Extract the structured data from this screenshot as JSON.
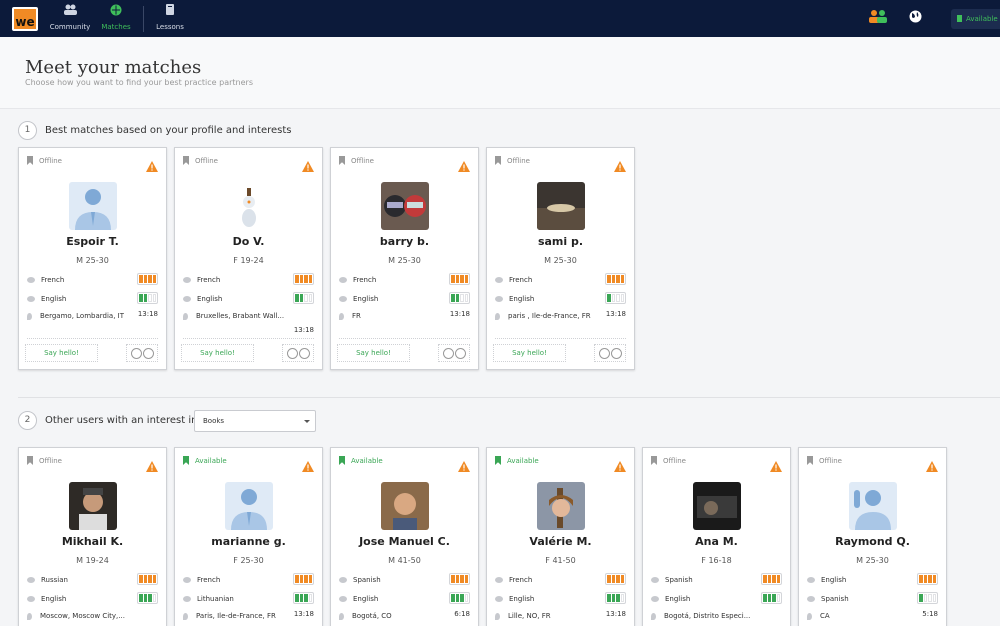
{
  "nav": {
    "logo_text": "we",
    "community": "Community",
    "matches": "Matches",
    "lessons": "Lessons",
    "availability": "Available"
  },
  "header": {
    "title": "Meet your matches",
    "subtitle": "Choose how you want to find your best practice partners"
  },
  "section1": {
    "number": "1",
    "label": "Best matches based on your profile and interests"
  },
  "section2": {
    "number": "2",
    "label": "Other users with an interest in",
    "select_value": "Books"
  },
  "cards_row1": [
    {
      "status": "Offline",
      "name": "Espoir T.",
      "meta": "M 25-30",
      "lang1": "French",
      "lang2": "English",
      "lang2_level": 2,
      "location": "Bergamo, Lombardia, IT",
      "time": "13:18",
      "say": "Say hello!",
      "avatar": "silhouette"
    },
    {
      "status": "Offline",
      "name": "Do V.",
      "meta": "F 19-24",
      "lang1": "French",
      "lang2": "English",
      "lang2_level": 2,
      "location": "Bruxelles, Brabant Wall...",
      "time": "13:18",
      "say": "Say hello!",
      "avatar": "snowman"
    },
    {
      "status": "Offline",
      "name": "barry b.",
      "meta": "M 25-30",
      "lang1": "French",
      "lang2": "English",
      "lang2_level": 2,
      "location": "FR",
      "time": "13:18",
      "say": "Say hello!",
      "avatar": "photo-helmets"
    },
    {
      "status": "Offline",
      "name": "sami p.",
      "meta": "M 25-30",
      "lang1": "French",
      "lang2": "English",
      "lang2_level": 1,
      "location": "paris , Ile-de-France, FR",
      "time": "13:18",
      "say": "Say hello!",
      "avatar": "photo-sunset"
    }
  ],
  "cards_row2": [
    {
      "status": "Offline",
      "name": "Mikhail K.",
      "meta": "M 19-24",
      "lang1": "Russian",
      "lang2": "English",
      "lang2_level": 3,
      "location": "Moscow, Moscow City,...",
      "time": "",
      "avatar": "photo-man"
    },
    {
      "status": "Available",
      "name": "marianne g.",
      "meta": "F 25-30",
      "lang1": "French",
      "lang2": "Lithuanian",
      "lang2_level": 3,
      "location": "Paris, Ile-de-France, FR",
      "time": "13:18",
      "avatar": "silhouette"
    },
    {
      "status": "Available",
      "name": "Jose Manuel C.",
      "meta": "M 41-50",
      "lang1": "Spanish",
      "lang2": "English",
      "lang2_level": 3,
      "location": "Bogotá, CO",
      "time": "6:18",
      "avatar": "photo-man2"
    },
    {
      "status": "Available",
      "name": "Valérie M.",
      "meta": "F 41-50",
      "lang1": "French",
      "lang2": "English",
      "lang2_level": 3,
      "location": "Lille, NO, FR",
      "time": "13:18",
      "avatar": "photo-woman"
    },
    {
      "status": "Offline",
      "name": "Ana M.",
      "meta": "F 16-18",
      "lang1": "Spanish",
      "lang2": "English",
      "lang2_level": 3,
      "location": "Bogotá, Distrito Especi...",
      "time": "",
      "avatar": "photo-dark"
    },
    {
      "status": "Offline",
      "name": "Raymond Q.",
      "meta": "M 25-30",
      "lang1": "English",
      "lang2": "Spanish",
      "lang2_level": 1,
      "location": "CA",
      "time": "5:18",
      "avatar": "silhouette-wave"
    }
  ],
  "colors": {
    "topbar": "#0c1a3a",
    "accent_green": "#3aa655",
    "accent_orange": "#f08a24"
  }
}
